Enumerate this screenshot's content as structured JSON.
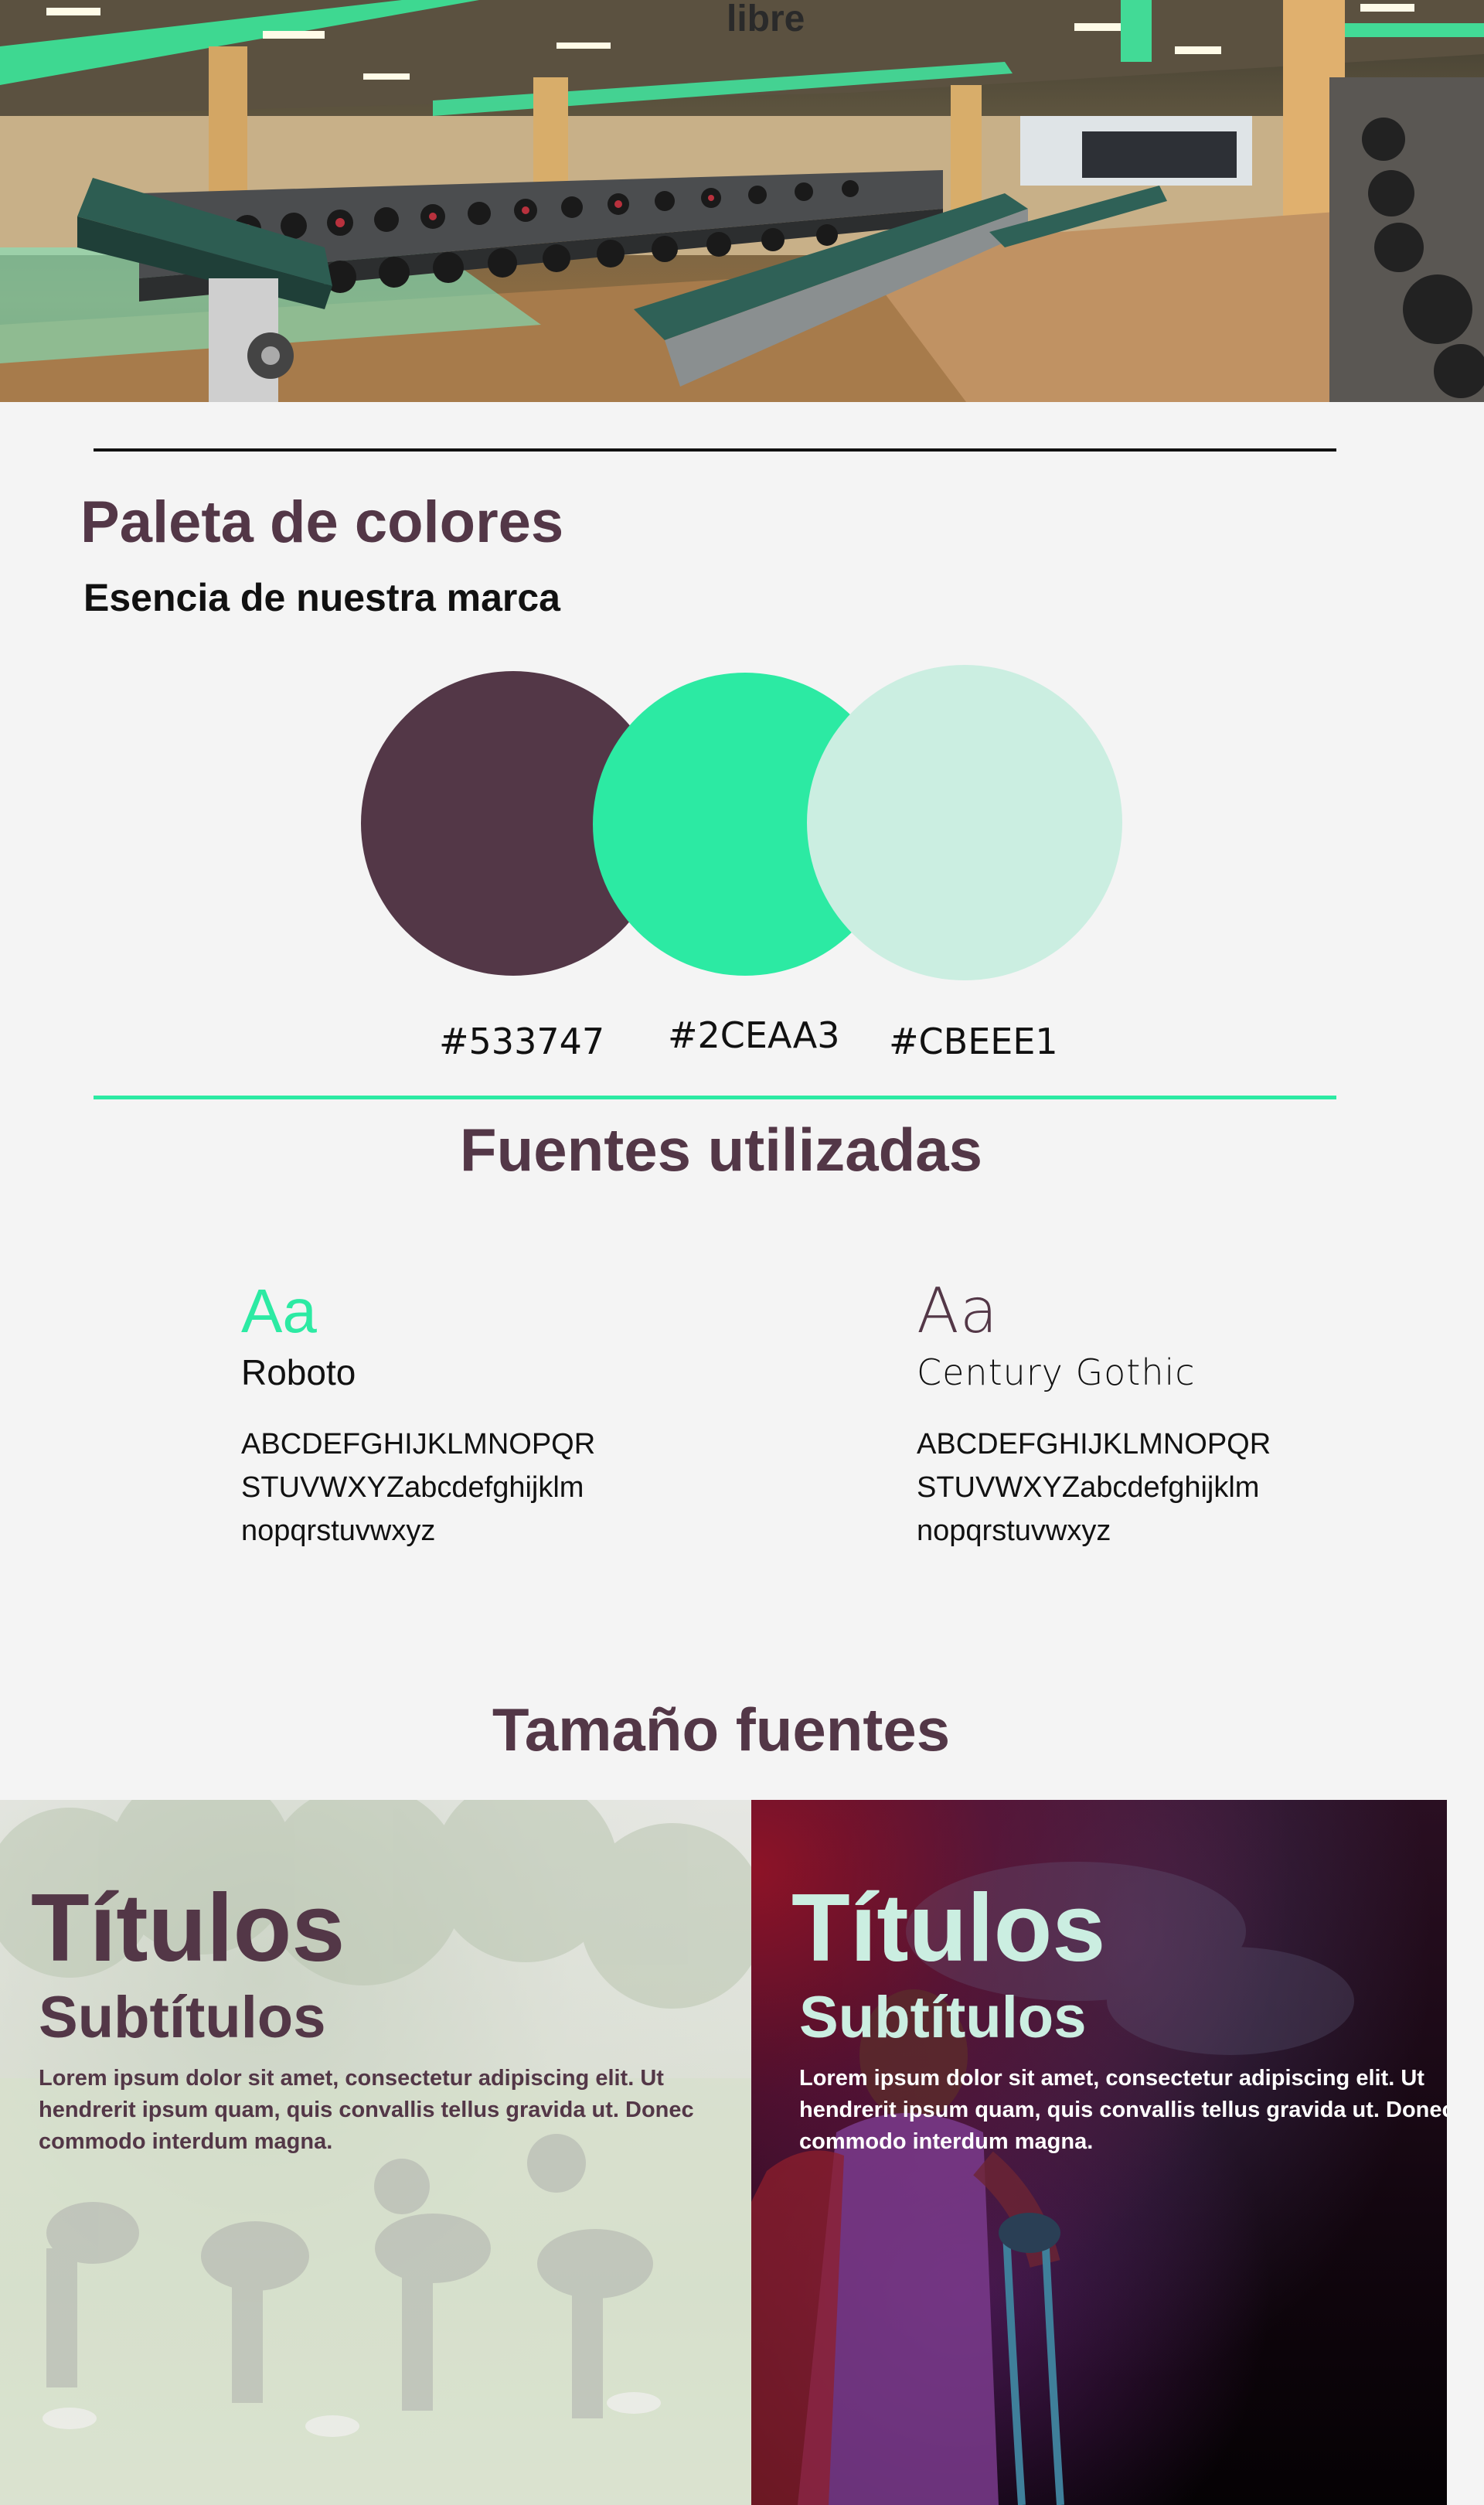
{
  "hero": {
    "sign_text": "libre"
  },
  "palette": {
    "title": "Paleta de colores",
    "subtitle": "Esencia de nuestra marca",
    "swatches": [
      {
        "hex": "#533747",
        "label": "#533747"
      },
      {
        "hex": "#2CEAA3",
        "label": "#2CEAA3"
      },
      {
        "hex": "#CBEEE1",
        "label": "#CBEEE1"
      }
    ]
  },
  "fonts": {
    "title": "Fuentes utilizadas",
    "items": [
      {
        "sample": "Aa",
        "name": "Roboto",
        "sample_color": "#2CEAA3",
        "alphabet": [
          "ABCDEFGHIJKLMNOPQR",
          "STUVWXYZabcdefghijklm",
          "nopqrstuvwxyz"
        ]
      },
      {
        "sample": "Aa",
        "name": "Century Gothic",
        "sample_color": "#533747",
        "alphabet": [
          "ABCDEFGHIJKLMNOPQR",
          "STUVWXYZabcdefghijklm",
          "nopqrstuvwxyz"
        ]
      }
    ]
  },
  "sizes": {
    "title": "Tamaño fuentes",
    "panels": [
      {
        "heading": "Títulos",
        "subheading": "Subtítulos",
        "body": "Lorem ipsum dolor sit amet, consectetur adipiscing elit. Ut hendrerit ipsum quam, quis convallis tellus gravida ut. Donec commodo interdum magna.",
        "heading_color": "#533747",
        "body_color": "#533747"
      },
      {
        "heading": "Títulos",
        "subheading": "Subtítulos",
        "body": "Lorem ipsum dolor sit amet, consectetur adipiscing elit. Ut hendrerit ipsum quam, quis convallis tellus gravida ut. Donec commodo interdum magna.",
        "heading_color": "#CBEEE1",
        "body_color": "#ffffff"
      }
    ]
  }
}
